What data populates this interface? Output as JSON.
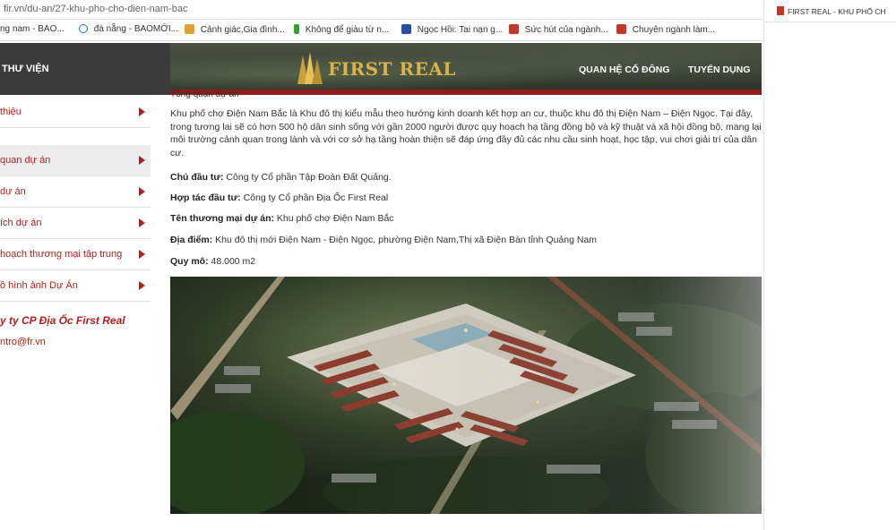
{
  "browser": {
    "url": "fir.vn/du-an/27-khu-pho-cho-dien-nam-bac",
    "bookmarks": [
      {
        "label": "ng nam - BAO...",
        "icon": "page-icon",
        "color": "#888888"
      },
      {
        "label": "đà nẵng - BAOMỚI...",
        "icon": "globe-icon",
        "color": "#1a73e8"
      },
      {
        "label": "Cảnh giác,Gia đình...",
        "icon": "folder-icon",
        "color": "#e0a23c"
      },
      {
        "label": "Không để giàu từ n...",
        "icon": "bookmark-icon",
        "color": "#3a9b3a"
      },
      {
        "label": "Ngọc Hồi: Tai nạn g...",
        "icon": "news-icon",
        "color": "#2a4fa0"
      },
      {
        "label": "Sức hút của ngành...",
        "icon": "news-icon",
        "color": "#c0392b"
      },
      {
        "label": "Chuyên ngành làm...",
        "icon": "news-icon",
        "color": "#c0392b"
      }
    ],
    "side_tab_title": "FIRST REAL - KHU PHỐ CH"
  },
  "header": {
    "left_label": "THƯ VIỆN",
    "logo_text": "FIRST REAL",
    "nav": [
      "QUAN HỆ CỔ ĐÔNG",
      "TUYỂN DỤNG"
    ],
    "accent_color": "#8e1c1c",
    "logo_color": "#d9b24a"
  },
  "sidebar": {
    "items": [
      {
        "label": "thiệu",
        "active": false
      },
      {
        "label": "quan dự án",
        "active": true
      },
      {
        "label": "dự án",
        "active": false
      },
      {
        "label": "ích dự án",
        "active": false
      },
      {
        "label": "hoạch thương mại tập trung",
        "active": false
      },
      {
        "label": "ồ hình ảnh Dự Án",
        "active": false
      }
    ],
    "company": "y ty CP Địa Ốc First Real",
    "email": "ntro@fr.vn",
    "text_color": "#b01e1e"
  },
  "content": {
    "section_title": "Tổng quan dự án",
    "intro": "Khu phố chợ Điện Nam Bắc là Khu đô thị kiểu mẫu theo hướng kinh doanh kết hợp an cư, thuộc khu đô thị Điện Nam – Điện Ngọc. Tại đây, trong tương lai sẽ có hơn 500 hộ dân sinh sống với gần 2000 người được quy hoạch hạ tầng đồng bộ và kỹ thuật và xã hội đồng bộ, mang lại môi trường cảnh quan trong lành và với cơ sở hạ tầng hoàn thiện sẽ đáp ứng đầy đủ các nhu cầu sinh hoạt, học tập, vui chơi giải trí của dân cư.",
    "fields": [
      {
        "label": "Chủ đầu tư:",
        "value": " Công ty Cổ phần Tập Đoàn Đất Quảng."
      },
      {
        "label": "Hợp tác đầu tư:",
        "value": " Công ty Cổ phần Địa Ốc First Real"
      },
      {
        "label": "Tên thương mại dự án:",
        "value": " Khu phố chợ Điện Nam Bắc"
      },
      {
        "label": "Địa điểm:",
        "value": " Khu đô thị mới Điện Nam - Điện Ngọc, phường Điện Nam,Thị xã Điện Bàn tỉnh Quảng Nam"
      },
      {
        "label": "Quy mô:",
        "value": " 48.000 m2"
      }
    ]
  }
}
